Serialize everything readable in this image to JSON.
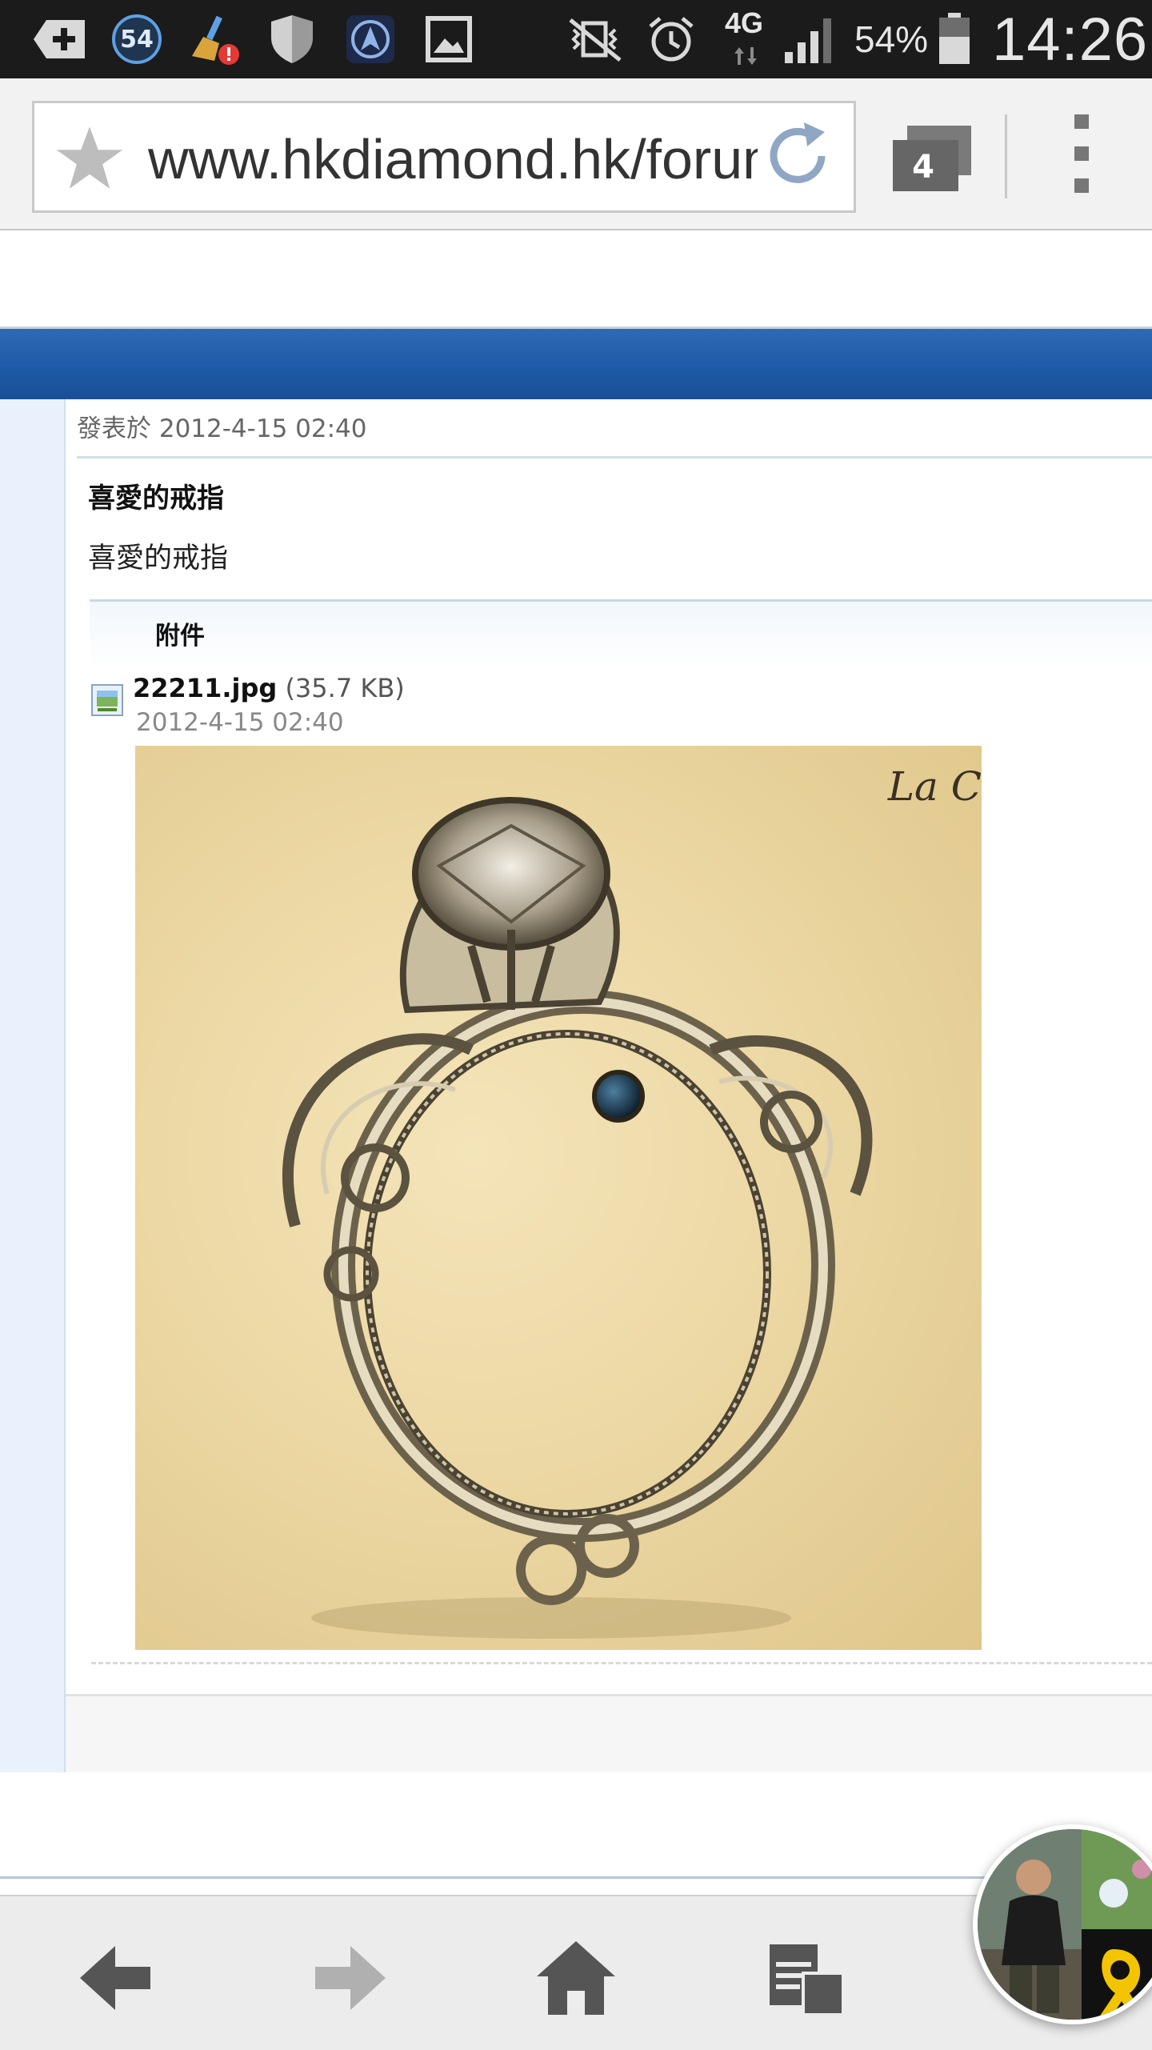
{
  "status_bar": {
    "notification_count": "54",
    "network_type": "4G",
    "battery_percent": "54%",
    "time": "14:26"
  },
  "browser": {
    "url": "www.hkdiamond.hk/forum",
    "tab_count": "4"
  },
  "post": {
    "posted_at": "發表於 2012-4-15 02:40",
    "title": "喜愛的戒指",
    "body": "喜愛的戒指",
    "attachment_section_label": "附件",
    "attachment": {
      "filename": "22211.jpg",
      "size": "(35.7 KB)",
      "date": "2012-4-15 02:40",
      "image_watermark": "La C"
    }
  },
  "nav": {
    "buttons": [
      "back",
      "forward",
      "home",
      "bookmarks"
    ]
  },
  "colors": {
    "forum_header_blue": "#1d58a6",
    "sidebar_light_blue": "#e9f2fc",
    "status_bar_bg": "#1b1b1b"
  }
}
